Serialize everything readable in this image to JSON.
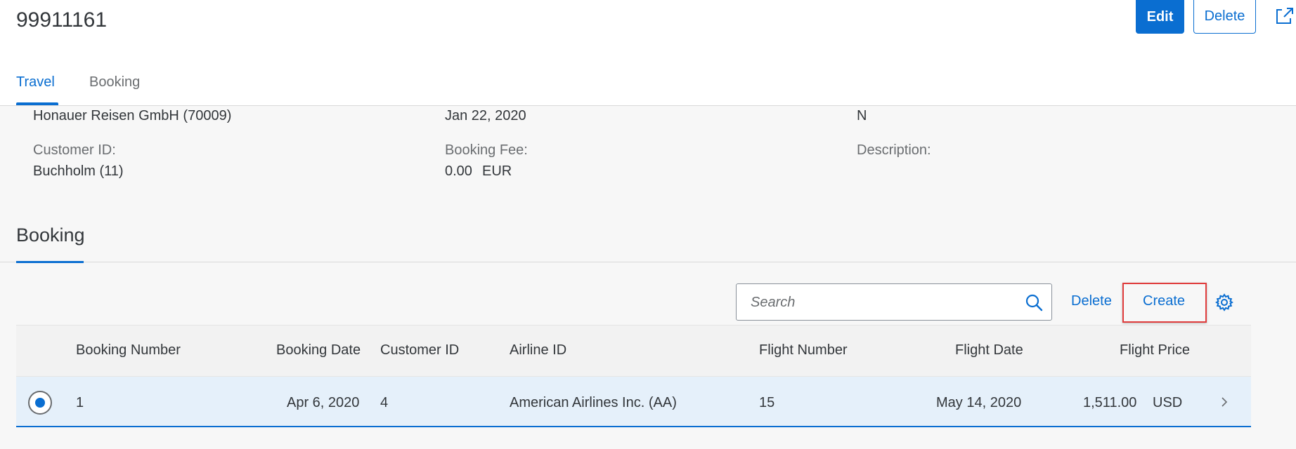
{
  "header": {
    "object_id": "99911161",
    "edit_label": "Edit",
    "delete_label": "Delete",
    "share_icon": "share-icon"
  },
  "tabs": [
    {
      "label": "Travel",
      "active": true
    },
    {
      "label": "Booking",
      "active": false
    }
  ],
  "travel": {
    "agency_value": "Honauer Reisen GmbH (70009)",
    "begin_date_value": "Jan 22, 2020",
    "status_value": "N",
    "customer_label": "Customer ID:",
    "customer_value": "Buchholm (11)",
    "booking_fee_label": "Booking Fee:",
    "booking_fee_amount": "0.00",
    "booking_fee_currency": "EUR",
    "description_label": "Description:"
  },
  "booking_section": {
    "title": "Booking",
    "search_placeholder": "Search",
    "delete_label": "Delete",
    "create_label": "Create",
    "settings_icon": "gear-icon"
  },
  "table": {
    "columns": [
      "Booking Number",
      "Booking Date",
      "Customer ID",
      "Airline ID",
      "Flight Number",
      "Flight Date",
      "Flight Price"
    ],
    "rows": [
      {
        "booking_number": "1",
        "booking_date": "Apr 6, 2020",
        "customer_id": "4",
        "airline_id": "American Airlines Inc. (AA)",
        "flight_number": "15",
        "flight_date": "May 14, 2020",
        "flight_price": "1,511.00",
        "currency": "USD",
        "selected": true
      }
    ]
  },
  "colors": {
    "accent": "#0a6ed1",
    "highlight_frame": "#e03c3c",
    "selected_row": "#e5f0fa"
  }
}
